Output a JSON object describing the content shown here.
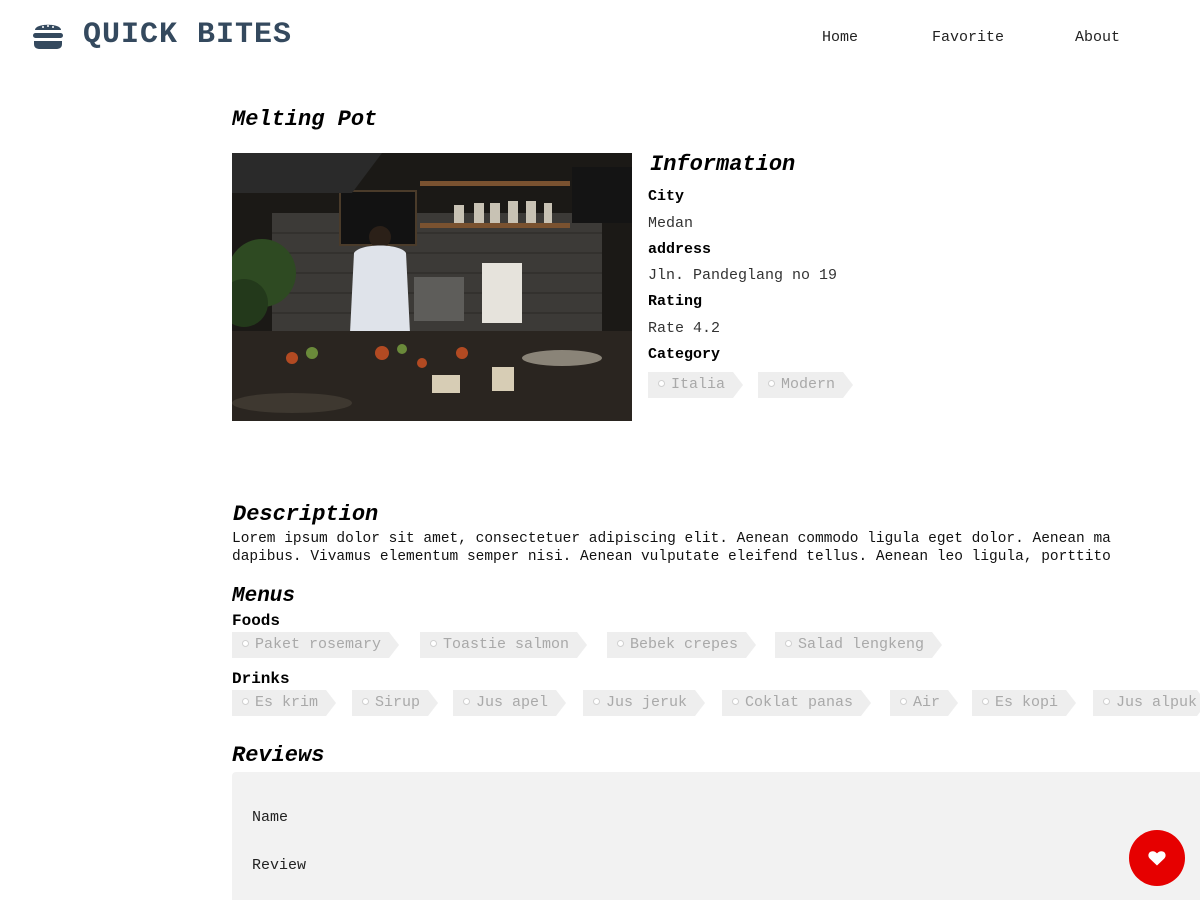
{
  "header": {
    "brand": "QUICK BITES",
    "logo_icon": "burger-icon",
    "nav": {
      "home": "Home",
      "favorite": "Favorite",
      "about": "About"
    }
  },
  "restaurant": {
    "name": "Melting Pot",
    "image_icon": "restaurant-photo"
  },
  "info": {
    "title": "Information",
    "city_label": "City",
    "city": "Medan",
    "address_label": "address",
    "address": "Jln. Pandeglang no 19",
    "rating_label": "Rating",
    "rating": "Rate 4.2",
    "category_label": "Category",
    "categories": [
      "Italia",
      "Modern"
    ]
  },
  "description": {
    "title": "Description",
    "line1": "Lorem ipsum dolor sit amet, consectetuer adipiscing elit. Aenean commodo ligula eget dolor. Aenean ma",
    "line2": "dapibus. Vivamus elementum semper nisi. Aenean vulputate eleifend tellus. Aenean leo ligula, porttito"
  },
  "menus": {
    "title": "Menus",
    "foods_label": "Foods",
    "foods": [
      "Paket rosemary",
      "Toastie salmon",
      "Bebek crepes",
      "Salad lengkeng"
    ],
    "drinks_label": "Drinks",
    "drinks": [
      "Es krim",
      "Sirup",
      "Jus apel",
      "Jus jeruk",
      "Coklat panas",
      "Air",
      "Es kopi",
      "Jus alpuk"
    ]
  },
  "reviews": {
    "title": "Reviews",
    "name_label": "Name",
    "review_label": "Review"
  },
  "fab": {
    "icon": "heart-icon",
    "color": "#e60000"
  },
  "colors": {
    "brand": "#34495e",
    "tag_bg": "#eeeeee",
    "tag_text": "#a9a9a9",
    "review_bg": "#f2f2f2"
  }
}
